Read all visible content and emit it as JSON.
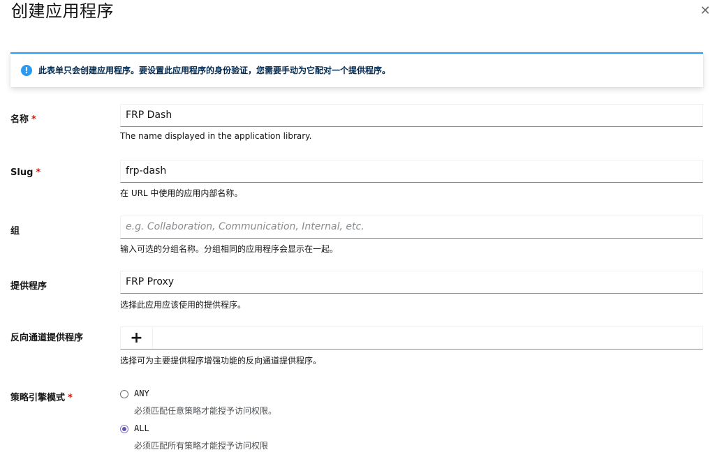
{
  "modal": {
    "title": "创建应用程序",
    "close_icon": "close-icon"
  },
  "alert": {
    "icon": "info-circle-icon",
    "text": "此表单只会创建应用程序。要设置此应用程序的身份验证，您需要手动为它配对一个提供程序。"
  },
  "fields": {
    "name": {
      "label": "名称",
      "required_mark": "*",
      "value": "FRP Dash",
      "helper": "The name displayed in the application library."
    },
    "slug": {
      "label": "Slug",
      "required_mark": "*",
      "value": "frp-dash",
      "helper": "在 URL 中使用的应用内部名称。"
    },
    "group": {
      "label": "组",
      "value": "",
      "placeholder": "e.g. Collaboration, Communication, Internal, etc.",
      "helper": "输入可选的分组名称。分组相同的应用程序会显示在一起。"
    },
    "provider": {
      "label": "提供程序",
      "value": "FRP Proxy",
      "helper": "选择此应用应该使用的提供程序。"
    },
    "backchannel": {
      "label": "反向通道提供程序",
      "add_button": "+",
      "helper": "选择可为主要提供程序增强功能的反向通道提供程序。"
    },
    "policy_mode": {
      "label": "策略引擎模式",
      "required_mark": "*",
      "options": [
        {
          "label": "ANY",
          "description": "必须匹配任意策略才能授予访问权限。",
          "checked": false
        },
        {
          "label": "ALL",
          "description": "必须匹配所有策略才能授予访问权限",
          "checked": true
        }
      ]
    }
  },
  "colors": {
    "accent_blue": "#2b9af3",
    "required_red": "#c9190b",
    "radio_purple": "#6753ac"
  }
}
